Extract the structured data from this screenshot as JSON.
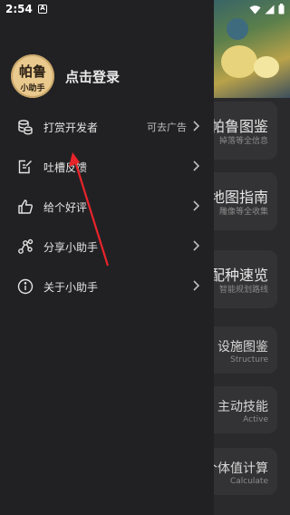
{
  "status_bar": {
    "time": "2:54",
    "notification_icon": "A"
  },
  "drawer": {
    "avatar": {
      "line1": "帕鲁",
      "line2": "小助手"
    },
    "login_label": "点击登录",
    "items": [
      {
        "label": "打赏开发者",
        "extra": "可去广告",
        "icon": "coins-icon"
      },
      {
        "label": "吐槽反馈",
        "extra": "",
        "icon": "feedback-edit-icon"
      },
      {
        "label": "给个好评",
        "extra": "",
        "icon": "thumbs-up-icon"
      },
      {
        "label": "分享小助手",
        "extra": "",
        "icon": "share-icon"
      },
      {
        "label": "关于小助手",
        "extra": "",
        "icon": "info-icon"
      }
    ]
  },
  "background": {
    "cards": [
      {
        "title": "帕鲁图鉴",
        "subtitle": "掉落等全信息"
      },
      {
        "title": "地图指南",
        "subtitle": "雕像等全收集"
      },
      {
        "title": "配种速览",
        "subtitle": "智能规划路线"
      },
      {
        "title": "设施图鉴",
        "subtitle": "Structure"
      },
      {
        "title": "主动技能",
        "subtitle": "Active"
      },
      {
        "title": "个体值计算",
        "subtitle": "Calculate"
      }
    ]
  },
  "colors": {
    "drawer_bg": "#212123",
    "arrow": "#e8232a",
    "accent": "#e9c98d"
  }
}
